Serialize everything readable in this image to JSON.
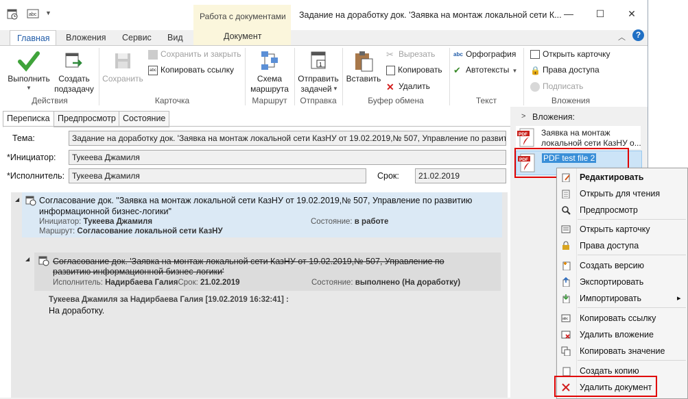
{
  "window": {
    "context_tab_group": "Работа с документами",
    "context_tab": "Документ",
    "title": "Задание на доработку док. 'Заявка на монтаж локальной сети К...",
    "minimize_glyph": "—",
    "maximize_glyph": "☐",
    "close_glyph": "✕"
  },
  "ribbon_tabs": [
    "Главная",
    "Вложения",
    "Сервис",
    "Вид"
  ],
  "ribbon": {
    "actions": {
      "execute": "Выполнить",
      "create_task_1": "Создать",
      "create_task_2": "подзадачу",
      "group": "Действия"
    },
    "card": {
      "save": "Сохранить",
      "save_close": "Сохранить и закрыть",
      "copy_link": "Копировать ссылку",
      "group": "Карточка"
    },
    "route": {
      "scheme_1": "Схема",
      "scheme_2": "маршрута",
      "group": "Маршрут"
    },
    "send": {
      "send_1": "Отправить",
      "send_2": "задачей",
      "group": "Отправка"
    },
    "clipboard": {
      "paste": "Вставить",
      "cut": "Вырезать",
      "copy": "Копировать",
      "delete": "Удалить",
      "group": "Буфер обмена"
    },
    "text": {
      "spelling": "Орфография",
      "autotext": "Автотексты",
      "group": "Текст"
    },
    "attachments": {
      "open_card": "Открыть карточку",
      "access": "Права доступа",
      "sign": "Подписать",
      "group": "Вложения"
    }
  },
  "content_tabs": [
    "Переписка",
    "Предпросмотр",
    "Состояние"
  ],
  "form": {
    "subject_label": "Тема:",
    "subject_value": "Задание на доработку док. 'Заявка на монтаж локальной сети КазНУ от 19.02.2019,№ 507, Управление по развитию",
    "initiator_label": "*Инициатор:",
    "initiator_value": "Тукеева Джамиля",
    "executor_label": "*Исполнитель:",
    "executor_value": "Тукеева Джамиля",
    "deadline_label": "Срок:",
    "deadline_value": "21.02.2019"
  },
  "tasks": {
    "main": {
      "title_1": "Согласование док. \"Заявка на монтаж локальной сети КазНУ от 19.02.2019,№ 507, Управление по развитию",
      "title_2": "информационной бизнес-логики\"",
      "initiator_label": "Инициатор:",
      "initiator": "Тукеева Джамиля",
      "route_label": "Маршрут:",
      "route": "Согласование локальной сети КазНУ",
      "state_label": "Состояние:",
      "state": "в работе"
    },
    "sub": {
      "title_1": "Согласование док. 'Заявка на монтаж локальной сети КазНУ от 19.02.2019,№ 507, Управление по",
      "title_2": "развитию информационной бизнес-логики'",
      "executor_label": "Исполнитель:",
      "executor": "Надирбаева Галия",
      "deadline_label": "Срок:",
      "deadline": "21.02.2019",
      "state_label": "Состояние:",
      "state": "выполнено (На доработку)"
    },
    "message": {
      "header": "Тукеева Джамиля за Надирбаева Галия [19.02.2019 16:32:41] :",
      "body": "На доработку."
    }
  },
  "attachments_panel": {
    "title": "Вложения:",
    "items": [
      {
        "line1": "Заявка на монтаж",
        "line2": "локальной сети КазНУ о...",
        "icon": "pdf-icon"
      },
      {
        "line1": "PDF test file 2",
        "line2": "",
        "icon": "pdf-icon"
      }
    ]
  },
  "context_menu": {
    "items": [
      {
        "label": "Редактировать",
        "icon": "edit-icon"
      },
      {
        "label": "Открыть для чтения",
        "icon": "read-icon"
      },
      {
        "label": "Предпросмотр",
        "icon": "magnifier-icon"
      },
      {
        "label": "Открыть карточку",
        "icon": "card-icon"
      },
      {
        "label": "Права доступа",
        "icon": "lock-icon"
      },
      {
        "label": "Создать версию",
        "icon": "new-version-icon"
      },
      {
        "label": "Экспортировать",
        "icon": "export-icon"
      },
      {
        "label": "Импортировать",
        "icon": "import-icon"
      },
      {
        "label": "Копировать ссылку",
        "icon": "link-icon"
      },
      {
        "label": "Удалить вложение",
        "icon": "delete-attachment-icon"
      },
      {
        "label": "Копировать значение",
        "icon": "copy-value-icon"
      },
      {
        "label": "Создать копию",
        "icon": "copy-icon"
      },
      {
        "label": "Удалить документ",
        "icon": "delete-x-icon"
      }
    ],
    "submenu_arrow": "▸"
  },
  "colors": {
    "accent": "#1f5ba8",
    "highlight": "#e00000",
    "selected": "#cce4f7"
  }
}
